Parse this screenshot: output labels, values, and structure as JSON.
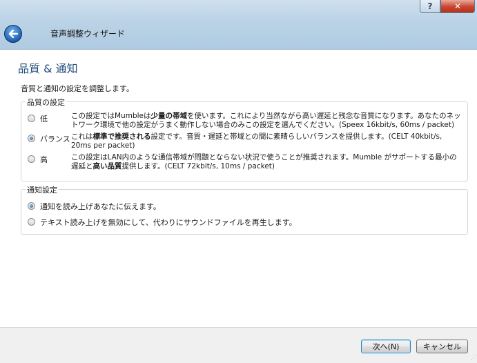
{
  "window": {
    "title": "音声調整ウィザード",
    "help_glyph": "?",
    "close_glyph": "✕"
  },
  "page": {
    "title": "品質 & 通知",
    "intro": "音質と通知の設定を調整します。"
  },
  "quality": {
    "legend": "品質の設定",
    "options": [
      {
        "label": "低",
        "checked": false,
        "desc_pre": "この設定ではMumbleは",
        "desc_bold": "少量の帯域",
        "desc_post": "を使います。これにより当然ながら高い遅延と残念な音質になります。あなたのネットワーク環境で他の設定がうまく動作しない場合のみこの設定を選んでください。(Speex 16kbit/s, 60ms / packet)"
      },
      {
        "label": "バランス",
        "checked": true,
        "desc_pre": "これは",
        "desc_bold": "標準で推奨される",
        "desc_post": "設定です。音質・遅延と帯域との間に素晴らしいバランスを提供します。(CELT 40kbit/s, 20ms per packet)"
      },
      {
        "label": "高",
        "checked": false,
        "desc_pre": "この設定はLAN内のような通信帯域が問題とならない状況で使うことが推奨されます。Mumble がサポートする最小の遅延と",
        "desc_bold": "高い品質",
        "desc_post": "提供します。(CELT 72kbit/s, 10ms / packet)"
      }
    ]
  },
  "notify": {
    "legend": "通知設定",
    "options": [
      {
        "label": "通知を読み上げあなたに伝えます。",
        "checked": true
      },
      {
        "label": "テキスト読み上げを無効にして、代わりにサウンドファイルを再生します。",
        "checked": false
      }
    ]
  },
  "footer": {
    "next_label": "次へ(N)",
    "cancel_label": "キャンセル"
  }
}
